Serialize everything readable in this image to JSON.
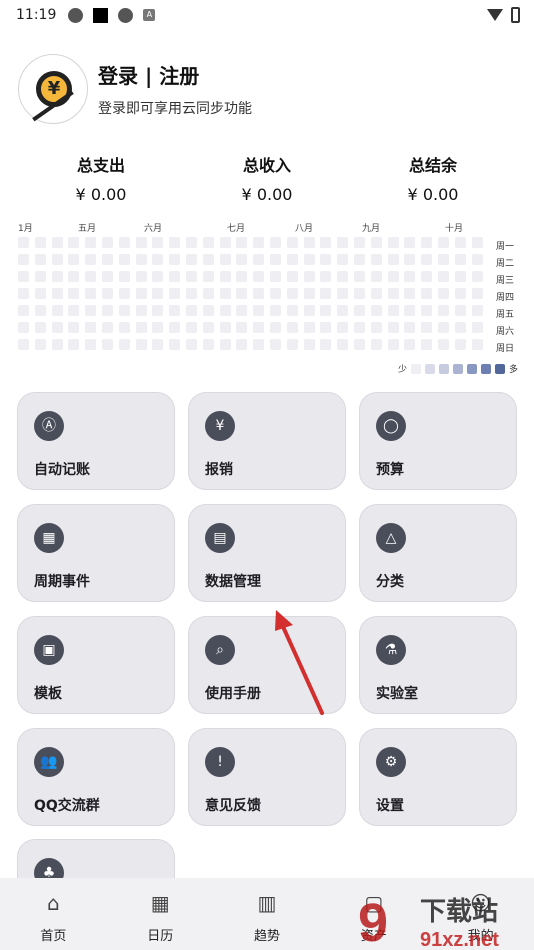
{
  "status_bar": {
    "time": "11:19",
    "small_badge": "A"
  },
  "profile": {
    "title": "登录 | 注册",
    "subtitle": "登录即可享用云同步功能"
  },
  "summary": [
    {
      "label": "总支出",
      "value": "¥ 0.00"
    },
    {
      "label": "总收入",
      "value": "¥ 0.00"
    },
    {
      "label": "总结余",
      "value": "¥ 0.00"
    }
  ],
  "heatmap": {
    "months": [
      "1月",
      "五月",
      "六月",
      "七月",
      "八月",
      "九月",
      "十月"
    ],
    "weekdays": [
      "周一",
      "周二",
      "周三",
      "周四",
      "周五",
      "周六",
      "周日"
    ],
    "legend_less": "少",
    "legend_more": "多",
    "legend_colors": [
      "#eeeef3",
      "#d9dbea",
      "#c6cbe0",
      "#aab3d2",
      "#8998c2",
      "#6c7fb0",
      "#53689a"
    ]
  },
  "cards": [
    {
      "label": "自动记账",
      "icon": "auto-account-icon"
    },
    {
      "label": "报销",
      "icon": "reimbursement-icon"
    },
    {
      "label": "预算",
      "icon": "budget-icon"
    },
    {
      "label": "周期事件",
      "icon": "calendar-icon"
    },
    {
      "label": "数据管理",
      "icon": "data-management-icon"
    },
    {
      "label": "分类",
      "icon": "category-icon"
    },
    {
      "label": "模板",
      "icon": "template-icon"
    },
    {
      "label": "使用手册",
      "icon": "manual-icon"
    },
    {
      "label": "实验室",
      "icon": "lab-icon"
    },
    {
      "label": "QQ交流群",
      "icon": "qq-group-icon"
    },
    {
      "label": "意见反馈",
      "icon": "feedback-icon"
    },
    {
      "label": "设置",
      "icon": "settings-icon"
    },
    {
      "label": "",
      "icon": "tree-icon"
    }
  ],
  "bottom_nav": [
    {
      "label": "首页",
      "icon": "home-icon"
    },
    {
      "label": "日历",
      "icon": "calendar-icon"
    },
    {
      "label": "趋势",
      "icon": "chart-icon"
    },
    {
      "label": "资产",
      "icon": "wallet-icon"
    },
    {
      "label": "我的",
      "icon": "profile-icon"
    }
  ],
  "watermark": {
    "text": "下载站",
    "domain": "91xz.net"
  },
  "colors": {
    "card_bg": "#e8e8ed",
    "icon_bg": "#4a4d5a",
    "arrow": "#d32f2f"
  }
}
